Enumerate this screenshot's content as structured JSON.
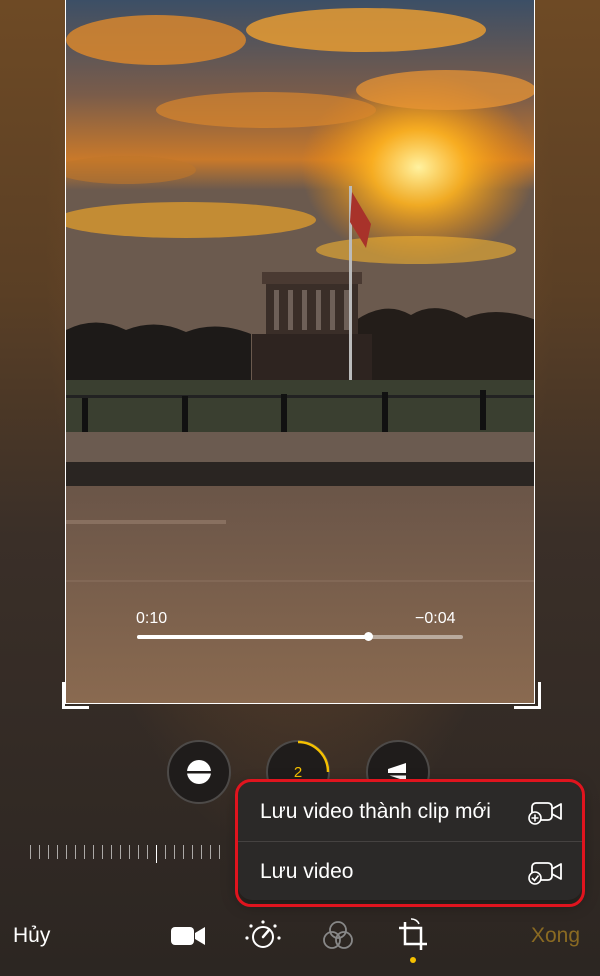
{
  "video": {
    "elapsed": "0:10",
    "remaining": "−0:04",
    "progress": 0.71
  },
  "adjust_buttons": {
    "straighten_icon": "level-icon",
    "vertical_value": "2",
    "horizontal_icon": "perspective-icon"
  },
  "save_menu": {
    "save_as_new_clip_label": "Lưu video thành clip mới",
    "save_as_new_clip_icon": "video-plus-icon",
    "save_video_label": "Lưu video",
    "save_video_icon": "video-check-icon"
  },
  "toolbar": {
    "cancel_label": "Hủy",
    "done_label": "Xong",
    "tools": [
      "video-icon",
      "adjust-dial-icon",
      "filters-icon",
      "crop-rotate-icon"
    ]
  },
  "colors": {
    "accent": "#f5c000",
    "highlight_border": "#e0141e",
    "menu_bg": "#2b2928"
  }
}
